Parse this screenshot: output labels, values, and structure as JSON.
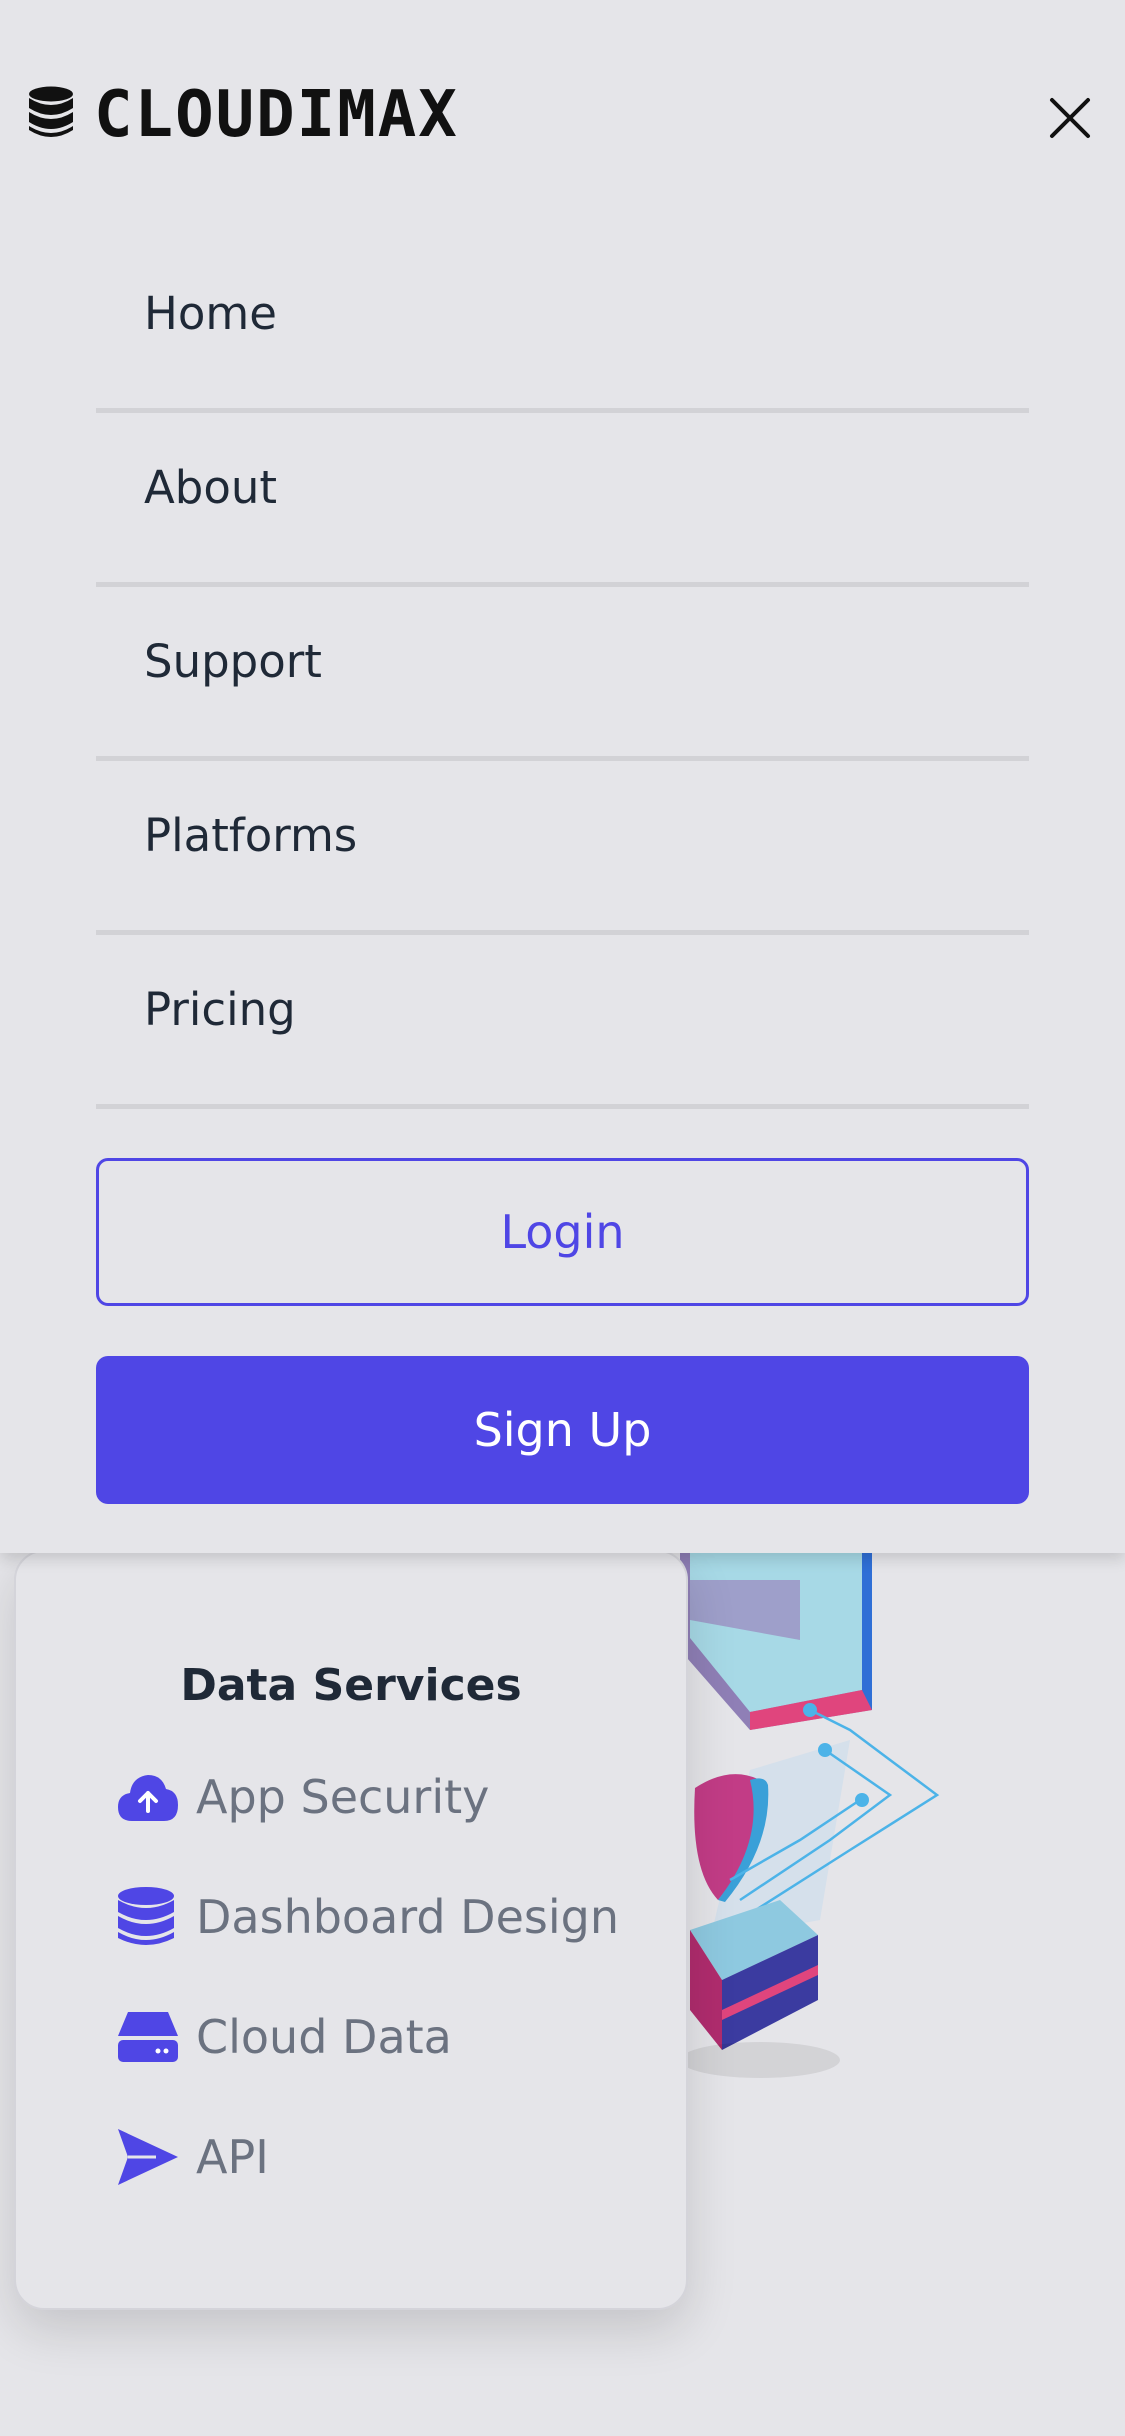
{
  "brand": {
    "name": "CLOUDIMAX"
  },
  "menu": {
    "items": [
      {
        "label": "Home"
      },
      {
        "label": "About"
      },
      {
        "label": "Support"
      },
      {
        "label": "Platforms"
      },
      {
        "label": "Pricing"
      }
    ],
    "login_label": "Login",
    "signup_label": "Sign Up"
  },
  "services": {
    "title": "Data Services",
    "items": [
      {
        "label": "App Security",
        "icon": "cloud-upload-icon"
      },
      {
        "label": "Dashboard Design",
        "icon": "database-icon"
      },
      {
        "label": "Cloud Data",
        "icon": "hard-drive-icon"
      },
      {
        "label": "API",
        "icon": "paper-plane-icon"
      }
    ]
  },
  "colors": {
    "accent": "#4f46e5",
    "background": "#e5e5e9",
    "text": "#1f2937",
    "muted": "#6b7280"
  }
}
